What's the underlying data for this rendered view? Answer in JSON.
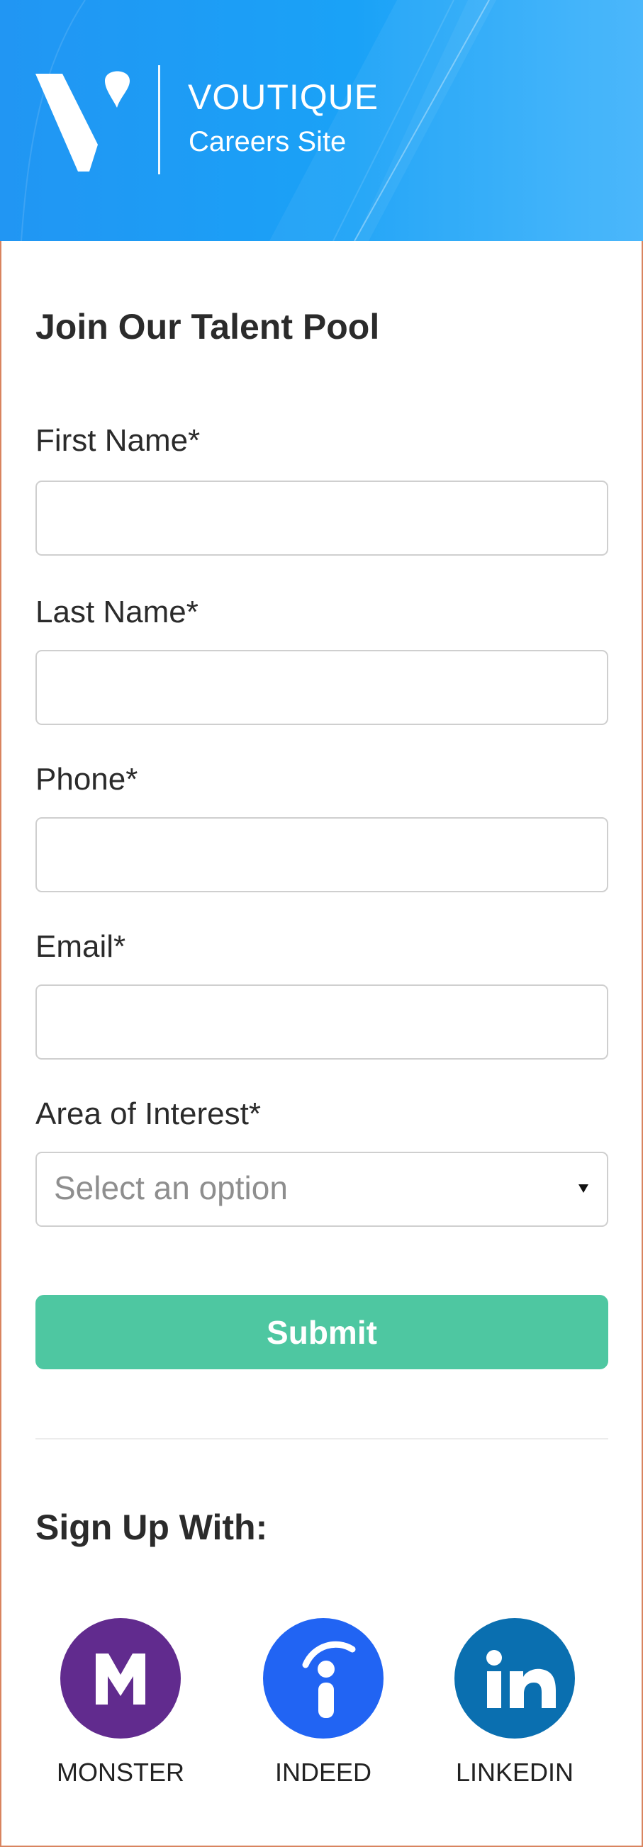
{
  "header": {
    "brand_name": "VOUTIQUE",
    "brand_subtitle": "Careers Site",
    "background_color": "#1e9ef5"
  },
  "form": {
    "title": "Join Our Talent Pool",
    "fields": [
      {
        "label": "First Name*",
        "value": "",
        "placeholder": ""
      },
      {
        "label": "Last Name*",
        "value": "",
        "placeholder": ""
      },
      {
        "label": "Phone*",
        "value": "",
        "placeholder": ""
      },
      {
        "label": "Email*",
        "value": "",
        "placeholder": ""
      }
    ],
    "area_of_interest": {
      "label": "Area of Interest*",
      "selected": "Select an option"
    },
    "submit_label": "Submit",
    "submit_color": "#4ec7a1"
  },
  "signup": {
    "title": "Sign Up With:",
    "providers": [
      {
        "label": "MONSTER",
        "icon": "monster-icon",
        "color": "#612b8e"
      },
      {
        "label": "INDEED",
        "icon": "indeed-icon",
        "color": "#2164f3"
      },
      {
        "label": "LINKEDIN",
        "icon": "linkedin-icon",
        "color": "#0a6fb0"
      }
    ]
  }
}
